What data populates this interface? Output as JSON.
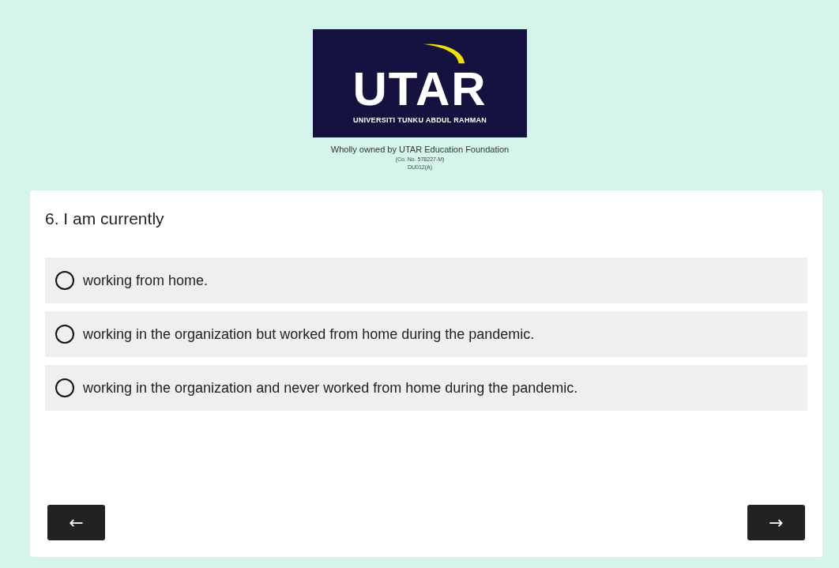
{
  "logo": {
    "wordmark": "UTAR",
    "subtitle": "UNIVERSITI TUNKU ABDUL RAHMAN"
  },
  "ownership": "Wholly owned by UTAR Education Foundation",
  "company_no": "(Co. No. 578227-M)",
  "registration": "DU012(A)",
  "question": {
    "title": "6. I am currently",
    "options": [
      {
        "label": "working from home.",
        "selected": false
      },
      {
        "label": "working in the organization but worked from home during the pandemic.",
        "selected": false
      },
      {
        "label": "working in the organization and never worked from home during the pandemic.",
        "selected": false
      }
    ]
  },
  "navigation": {
    "back": "←",
    "next": "→"
  }
}
